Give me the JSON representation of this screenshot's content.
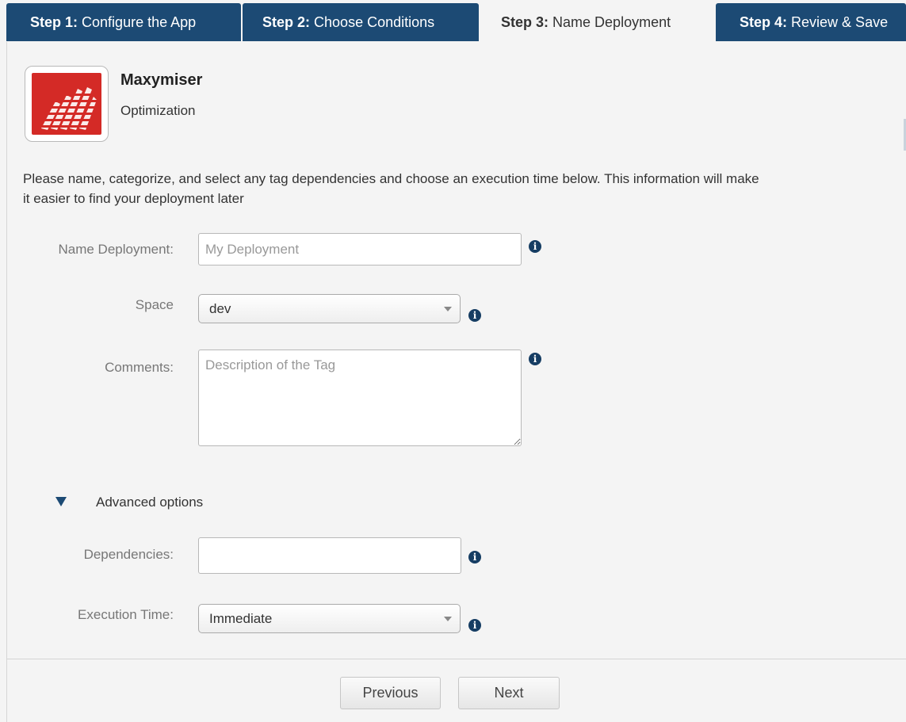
{
  "tabs": [
    {
      "step": "Step 1:",
      "label": "Configure the App"
    },
    {
      "step": "Step 2:",
      "label": "Choose Conditions"
    },
    {
      "step": "Step 3:",
      "label": "Name Deployment"
    },
    {
      "step": "Step 4:",
      "label": "Review & Save"
    }
  ],
  "active_tab": "Step 3",
  "app": {
    "name": "Maxymiser",
    "category": "Optimization",
    "logo_color": "#d42a26"
  },
  "intro_text": "Please name, categorize, and select any tag dependencies and choose an execution time below. This information will make it easier to find your deployment later",
  "form": {
    "name_label": "Name Deployment:",
    "name_placeholder": "My Deployment",
    "name_value": "",
    "space_label": "Space",
    "space_value": "dev",
    "comments_label": "Comments:",
    "comments_placeholder": "Description of the Tag",
    "comments_value": "",
    "info_icon": "i"
  },
  "advanced": {
    "label": "Advanced options",
    "dependencies_label": "Dependencies:",
    "dependencies_value": "",
    "execution_label": "Execution Time:",
    "execution_value": "Immediate"
  },
  "footer": {
    "previous_label": "Previous",
    "next_label": "Next"
  },
  "colors": {
    "tab_bg": "#1c4a74",
    "page_bg": "#f4f4f4",
    "info_icon": "#163d63"
  }
}
